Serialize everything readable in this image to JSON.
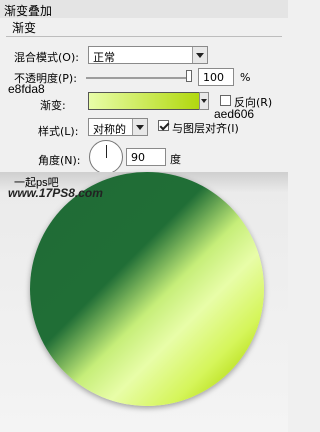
{
  "header": {
    "title": "渐变叠加",
    "subtitle": "渐变"
  },
  "blend": {
    "label": "混合模式(O):",
    "value": "正常"
  },
  "opacity": {
    "label": "不透明度(P):",
    "value": "100",
    "unit": "%",
    "level": 1.0
  },
  "gradient": {
    "label": "渐变:",
    "color_start": "e8fda8",
    "color_end": "aed606",
    "reverse_label": "反向(R)",
    "reverse_checked": false
  },
  "style": {
    "label": "样式(L):",
    "value": "对称的",
    "align_label": "与图层对齐(I)",
    "align_checked": true
  },
  "angle": {
    "label": "角度(N):",
    "value": "90",
    "unit": "度"
  },
  "watermark": {
    "line1": "一起ps吧",
    "line2": "www.17PS8.com"
  }
}
